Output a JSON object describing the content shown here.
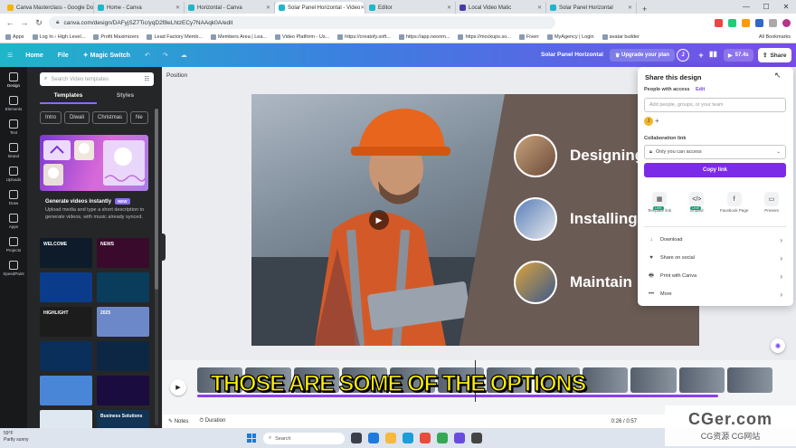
{
  "browser": {
    "tabs": [
      {
        "label": "Canva Masterclass - Google Do",
        "color": "#f4b400"
      },
      {
        "label": "Home - Canva",
        "color": "#1fb6c9"
      },
      {
        "label": "Horizontal - Canva",
        "color": "#1fb6c9"
      },
      {
        "label": "Solar Panel Horizontal - Video",
        "color": "#1fb6c9",
        "active": true
      },
      {
        "label": "Editor",
        "color": "#1fb6c9"
      },
      {
        "label": "Local Video Matic",
        "color": "#4a3aa8"
      },
      {
        "label": "Solar Panel Horizontal",
        "color": "#1fb6c9"
      }
    ],
    "url": "canva.com/design/DAFyjSZ7Tic/yqD2f8eLhtzECy7NAAqk0A/edit",
    "bookmarks": [
      "Apps",
      "Log In ‹ High Level...",
      "Profit Maximizers",
      "Lead Factory Memb...",
      "Members Area | Lea...",
      "Video Platform - Us...",
      "https://creatofy.soft...",
      "https://app.neonm...",
      "https://mockups.so...",
      "Fiverr",
      "MyAgency | Login",
      "avatar builder"
    ],
    "all_bookmarks": "All Bookmarks"
  },
  "header": {
    "home": "Home",
    "file": "File",
    "magic_switch": "Magic Switch",
    "design_title": "Solar Panel Horizontal",
    "upgrade": "Upgrade your plan",
    "avatar": "J",
    "play_time": "57.4s",
    "share": "Share"
  },
  "rail": [
    "Design",
    "Elements",
    "Text",
    "Brand",
    "Uploads",
    "Draw",
    "Apps",
    "Projects",
    "SpeedPaint"
  ],
  "panel": {
    "search_placeholder": "Search Video templates",
    "tab_templates": "Templates",
    "tab_styles": "Styles",
    "chips": [
      "Intro",
      "Diwali",
      "Christmas",
      "Ne"
    ],
    "promo_title": "Generate videos instantly",
    "promo_badge": "NEW",
    "promo_desc": "Upload media and type a short description to generate videos, with music already synced.",
    "templates": [
      {
        "label": "WELCOME",
        "bg": "#0d1b2a"
      },
      {
        "label": "NEWS",
        "bg": "#3a0a2c"
      },
      {
        "label": "",
        "bg": "#0b3c8c"
      },
      {
        "label": "",
        "bg": "#0a3d5c"
      },
      {
        "label": "HIGHLIGHT",
        "bg": "#1c1c1c"
      },
      {
        "label": "2025",
        "bg": "#6d88c9"
      },
      {
        "label": "",
        "bg": "#0a2f5a"
      },
      {
        "label": "",
        "bg": "#0b2744"
      },
      {
        "label": "",
        "bg": "#4a86d8"
      },
      {
        "label": "",
        "bg": "#1a0c3e"
      },
      {
        "label": "",
        "bg": "#dfe8f1"
      },
      {
        "label": "Business Solutions",
        "bg": "#113355"
      }
    ]
  },
  "canvas": {
    "context_label": "Position",
    "items": [
      "Designing",
      "Installing",
      "Maintain"
    ]
  },
  "share_panel": {
    "title": "Share this design",
    "people_label": "People with access",
    "edit": "Edit",
    "input_placeholder": "Add people, groups, or your team",
    "avatar": "J",
    "collab_label": "Collaboration link",
    "access": "Only you can access",
    "copy_link": "Copy link",
    "options": [
      {
        "label": "Template link",
        "icon": "▦",
        "tag": "LIVE"
      },
      {
        "label": "Embed",
        "icon": "</>",
        "tag": "LIVE"
      },
      {
        "label": "Facebook Page",
        "icon": "f",
        "tag": ""
      },
      {
        "label": "Present",
        "icon": "▭",
        "tag": ""
      }
    ],
    "list": [
      {
        "label": "Download",
        "icon": "↓"
      },
      {
        "label": "Share on social",
        "icon": "♥"
      },
      {
        "label": "Print with Canva",
        "icon": "🖶"
      },
      {
        "label": "More",
        "icon": "•••"
      }
    ]
  },
  "caption": "THOSE ARE SOME OF THE OPTIONS",
  "bottom": {
    "notes": "Notes",
    "duration": "Duration",
    "time": "0:26 / 0:57"
  },
  "taskbar": {
    "temp": "59°F",
    "weather": "Partly sunny",
    "search": "Search"
  },
  "watermark": {
    "main": "CGer.com",
    "sub": "CG资源 CG网站"
  },
  "colors": {
    "accent": "#7d2ae8",
    "caption": "#fff200",
    "design_bg": "#6b5b55"
  }
}
